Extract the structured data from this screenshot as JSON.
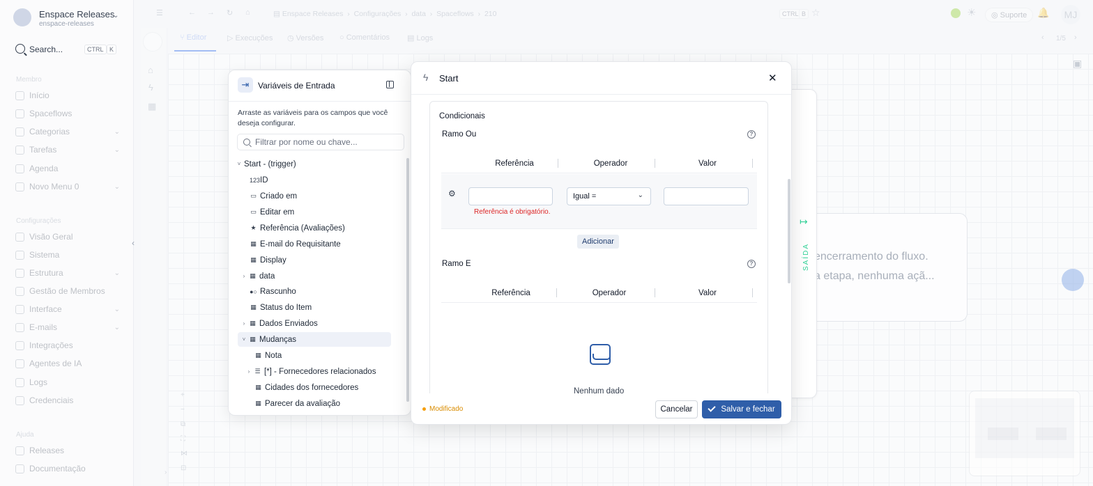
{
  "workspace": {
    "name": "Enspace Releases",
    "slug": "enspace-releases"
  },
  "search": {
    "label": "Search...",
    "shortcut_ctrl": "CTRL",
    "shortcut_key": "K"
  },
  "sidebar": {
    "member_title": "Membro",
    "member_items": [
      {
        "label": "Início",
        "icon": "home-icon"
      },
      {
        "label": "Spaceflows",
        "icon": "flow-icon"
      },
      {
        "label": "Categorias",
        "icon": "grid-icon"
      },
      {
        "label": "Tarefas",
        "icon": "file-icon"
      },
      {
        "label": "Agenda",
        "icon": "calendar-icon"
      },
      {
        "label": "Novo Menu 0",
        "icon": "keyboard-icon"
      }
    ],
    "config_title": "Configurações",
    "config_items": [
      {
        "label": "Visão Geral",
        "icon": "overview-icon"
      },
      {
        "label": "Sistema",
        "icon": "gear-icon"
      },
      {
        "label": "Estrutura",
        "icon": "structure-icon"
      },
      {
        "label": "Gestão de Membros",
        "icon": "members-icon"
      },
      {
        "label": "Interface",
        "icon": "interface-icon"
      },
      {
        "label": "E-mails",
        "icon": "mail-icon"
      },
      {
        "label": "Integrações",
        "icon": "integration-icon"
      },
      {
        "label": "Agentes de IA",
        "icon": "ai-icon"
      },
      {
        "label": "Logs",
        "icon": "logs-icon"
      },
      {
        "label": "Credenciais",
        "icon": "key-icon"
      }
    ],
    "help_title": "Ajuda",
    "help_items": [
      {
        "label": "Releases",
        "icon": "releases-icon"
      },
      {
        "label": "Documentação",
        "icon": "doc-icon"
      }
    ]
  },
  "breadcrumb": [
    "Enspace Releases",
    "Configurações",
    "data",
    "Spaceflows",
    "210"
  ],
  "topbar": {
    "shortcut_ctrl": "CTRL",
    "shortcut_key": "B",
    "support_label": "Suporte",
    "user_initials": "MJ"
  },
  "tabs": [
    "Editor",
    "Execuções",
    "Versões",
    "Comentários",
    "Logs"
  ],
  "pager": "1/5",
  "canvas": {
    "ghost_line1": "encerramento do fluxo.",
    "ghost_line2": "a etapa, nenhuma açã...",
    "saida_label": "SAÍDA"
  },
  "variables_panel": {
    "title": "Variáveis de Entrada",
    "description": "Arraste as variáveis para os campos que você deseja configurar.",
    "filter_placeholder": "Filtrar por nome ou chave...",
    "tree": [
      {
        "label": "Start - (trigger)",
        "icon": "",
        "chevron": "˅"
      },
      {
        "label": "ID",
        "icon": "123",
        "chevron": ""
      },
      {
        "label": "Criado em",
        "icon": "▭",
        "chevron": ""
      },
      {
        "label": "Editar em",
        "icon": "▭",
        "chevron": ""
      },
      {
        "label": "Referência (Avaliações)",
        "icon": "★",
        "chevron": ""
      },
      {
        "label": "E-mail do Requisitante",
        "icon": "▦",
        "chevron": ""
      },
      {
        "label": "Display",
        "icon": "▦",
        "chevron": ""
      },
      {
        "label": "data",
        "icon": "▦",
        "chevron": "›"
      },
      {
        "label": "Rascunho",
        "icon": "●○",
        "chevron": ""
      },
      {
        "label": "Status do Item",
        "icon": "▦",
        "chevron": ""
      },
      {
        "label": "Dados Enviados",
        "icon": "▦",
        "chevron": "›"
      },
      {
        "label": "Mudanças",
        "icon": "▦",
        "chevron": "˅"
      },
      {
        "label": "Nota",
        "icon": "▦",
        "chevron": ""
      },
      {
        "label": "[*] - Fornecedores relacionados",
        "icon": "☰",
        "chevron": "›"
      },
      {
        "label": "Cidades dos fornecedores",
        "icon": "▦",
        "chevron": ""
      },
      {
        "label": "Parecer da avaliação",
        "icon": "▦",
        "chevron": ""
      }
    ]
  },
  "modal": {
    "title": "Start",
    "section_title": "Condicionais",
    "branch_or": {
      "title": "Ramo Ou",
      "headers": [
        "Referência",
        "Operador",
        "Valor"
      ],
      "operator_value": "Igual =",
      "error": "Referência é obrigatório.",
      "add_label": "Adicionar"
    },
    "branch_and": {
      "title": "Ramo E",
      "headers": [
        "Referência",
        "Operador",
        "Valor"
      ],
      "empty_text": "Nenhum dado"
    },
    "status": "Modificado",
    "cancel_label": "Cancelar",
    "save_label": "Salvar e fechar"
  },
  "colors": {
    "accent": "#2f5ea9",
    "error": "#dc2626",
    "modified": "#d98c00",
    "saida": "#34d399"
  }
}
